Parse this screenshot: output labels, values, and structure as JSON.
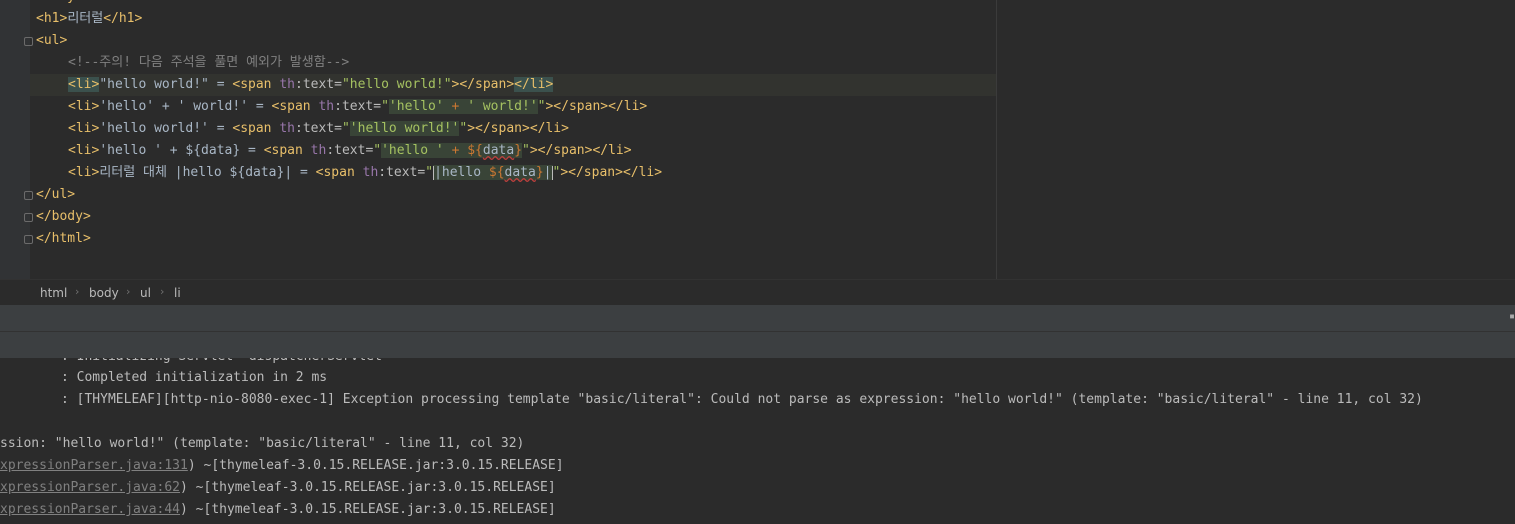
{
  "editor": {
    "lines": [
      {
        "id": "l0",
        "text_tag_open": "<body>"
      },
      {
        "id": "l1"
      },
      {
        "id": "l2"
      },
      {
        "id": "l3",
        "comment": "<!--주의! 다음 주석을 풀면 예외가 발생함-->"
      }
    ],
    "h1_text": "리터럴",
    "line_li1": {
      "open": "<li>",
      "text": "\"hello world!\" = ",
      "span_open": "<span ",
      "ns": "th",
      "attr": ":text=",
      "val": "\"hello world!\"",
      "end": "></span>",
      "close": "</li>"
    },
    "line_li2": {
      "text": "'hello' + ' world!' = ",
      "val": "'hello' + ' world!'"
    },
    "line_li3": {
      "text": "'hello world!' = ",
      "val": "'hello world!'"
    },
    "line_li4": {
      "text": "'hello ' + ${data} = ",
      "val_a": "'hello ' + ",
      "val_b": "${",
      "val_c": "data",
      "val_d": "}"
    },
    "line_li5": {
      "text": "리터럴 대체 |hello ${data}| = ",
      "val_a": "|hello ",
      "val_b": "${",
      "val_c": "data",
      "val_d": "}|"
    }
  },
  "breadcrumb": [
    "html",
    "body",
    "ul",
    "li"
  ],
  "console": {
    "lines": [
      ": Initializing Servlet 'dispatcherServlet'",
      ": Completed initialization in 2 ms",
      ": [THYMELEAF][http-nio-8080-exec-1] Exception processing template \"basic/literal\": Could not parse as expression: \"hello world!\" (template: \"basic/literal\" - line 11, col 32)",
      "",
      "ssion: \"hello world!\" (template: \"basic/literal\" - line 11, col 32)"
    ],
    "trace": [
      {
        "link": "xpressionParser.java:131",
        "rest": ") ~[thymeleaf-3.0.15.RELEASE.jar:3.0.15.RELEASE]"
      },
      {
        "link": "xpressionParser.java:62",
        "rest": ") ~[thymeleaf-3.0.15.RELEASE.jar:3.0.15.RELEASE]"
      },
      {
        "link": "xpressionParser.java:44",
        "rest": ") ~[thymeleaf-3.0.15.RELEASE.jar:3.0.15.RELEASE]"
      }
    ]
  }
}
